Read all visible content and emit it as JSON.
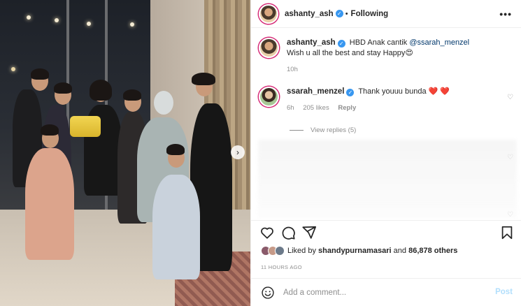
{
  "header": {
    "username": "ashanty_ash",
    "separator": "•",
    "follow_label": "Following",
    "more_icon": "more-horizontal-icon"
  },
  "caption": {
    "username": "ashanty_ash",
    "text_prefix": "HBD Anak cantik",
    "mention": "@ssarah_menzel",
    "line2": "Wish u all the best and stay Happy",
    "emoji": "😍",
    "time": "10h"
  },
  "comments": [
    {
      "username": "ssarah_menzel",
      "text": "Thank youuu bunda",
      "hearts": "❤️ ❤️",
      "time": "6h",
      "likes": "205 likes",
      "reply_label": "Reply",
      "view_replies": "View replies (5)"
    }
  ],
  "likes": {
    "prefix": "Liked by",
    "user": "shandypurnamasari",
    "joiner": "and",
    "count": "86,878 others"
  },
  "timestamp": "11 HOURS AGO",
  "add_comment": {
    "placeholder": "Add a comment...",
    "post_label": "Post"
  },
  "colors": {
    "accent": "#3897f0",
    "post_disabled": "#b2dffc",
    "heart": "#ed4956",
    "muted": "#8e8e8e"
  }
}
